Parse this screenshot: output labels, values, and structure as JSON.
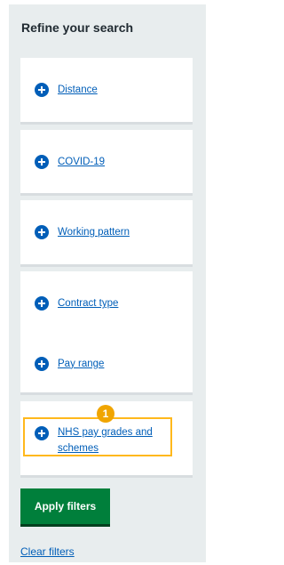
{
  "filters": {
    "title": "Refine your search",
    "items": [
      {
        "label": "Distance"
      },
      {
        "label": "COVID-19"
      },
      {
        "label": "Working pattern"
      },
      {
        "label": "Contract type"
      },
      {
        "label": "Pay range"
      },
      {
        "label": "NHS pay grades and schemes"
      }
    ],
    "focus_marker": "1",
    "apply_label": "Apply filters",
    "clear_label": "Clear filters"
  },
  "colors": {
    "panel": "#e8edee",
    "link": "#005eb8",
    "apply_button": "#007f3b",
    "focus": "#ffb81c",
    "marker": "#f0a500"
  },
  "icons": {
    "expand": "plus-circle-icon"
  }
}
